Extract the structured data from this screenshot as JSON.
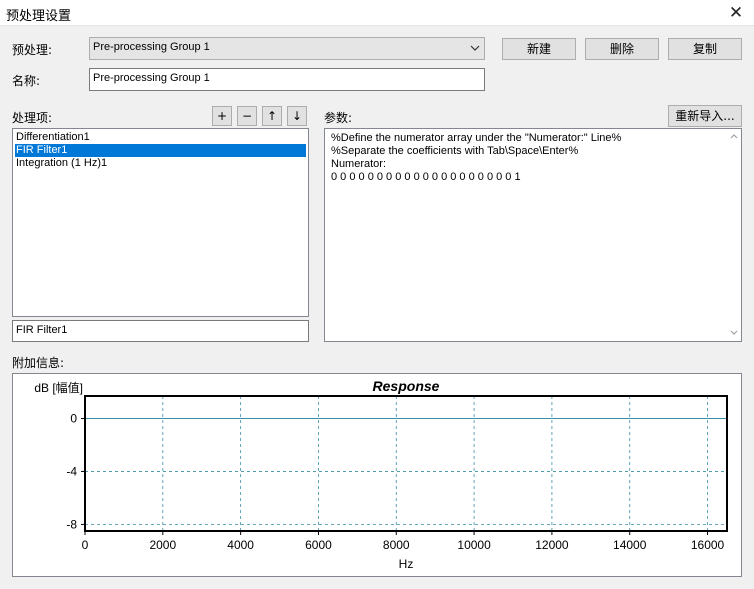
{
  "window": {
    "title": "预处理设置"
  },
  "preprocess": {
    "label": "预处理:",
    "selected": "Pre-processing Group 1",
    "new_button": "新建",
    "delete_button": "删除",
    "copy_button": "复制"
  },
  "name": {
    "label": "名称:",
    "value": "Pre-processing Group 1"
  },
  "items": {
    "label": "处理项:",
    "add": "+",
    "remove": "−",
    "up": "↑",
    "down": "↓",
    "list": [
      {
        "label": "Differentiation1",
        "selected": false
      },
      {
        "label": "FIR Filter1",
        "selected": true
      },
      {
        "label": "Integration (1 Hz)1",
        "selected": false
      }
    ],
    "current_name": "FIR Filter1"
  },
  "params": {
    "label": "参数:",
    "reimport_button": "重新导入...",
    "lines": [
      "%Define the numerator array under the \"Numerator:\" Line%",
      "%Separate the coefficients with Tab\\Space\\Enter%",
      "Numerator:",
      "0 0 0 0 0 0 0 0 0 0 0 0 0 0 0 0 0 0  0 0 1"
    ]
  },
  "extra_info": {
    "label": "附加信息:"
  },
  "colors": {
    "selection": "#0078d7",
    "grid_line": "#3a8fa8",
    "zero_line": "#3a8fa8"
  },
  "chart_data": {
    "type": "line",
    "title": "Response",
    "xlabel": "Hz",
    "ylabel": "dB [幅值]",
    "xlim": [
      0,
      16500
    ],
    "ylim": [
      -8.5,
      1.7
    ],
    "x_ticks": [
      0,
      2000,
      4000,
      6000,
      8000,
      10000,
      12000,
      14000,
      16000
    ],
    "y_ticks": [
      0,
      -4,
      -8
    ],
    "grid": true,
    "series": [
      {
        "x": [
          0,
          16500
        ],
        "y": [
          0,
          0
        ]
      }
    ]
  }
}
